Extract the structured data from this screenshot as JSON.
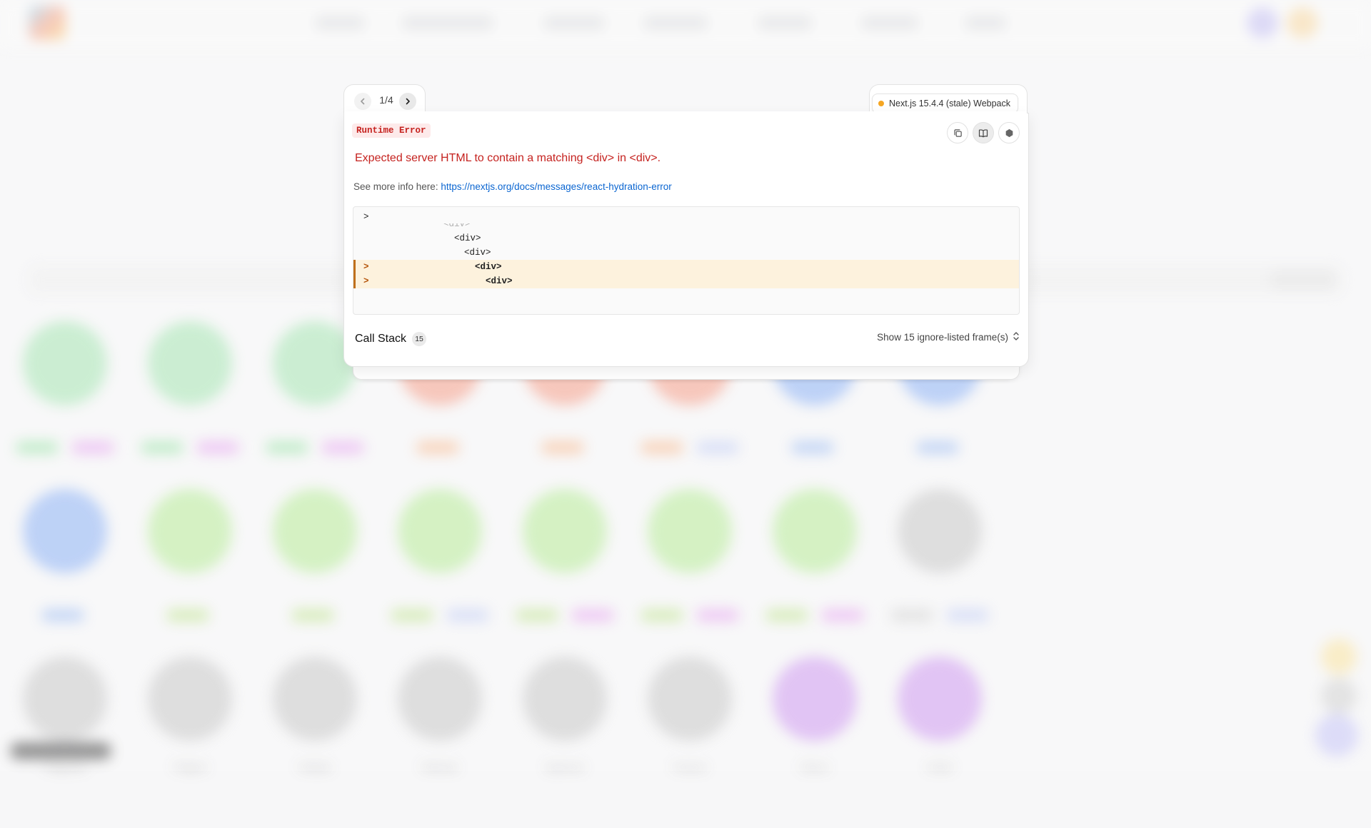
{
  "overlay": {
    "pagination": {
      "current": "1/4",
      "prev_icon": "chevron-left-icon",
      "next_icon": "chevron-right-icon"
    },
    "version": {
      "text": "Next.js 15.4.4 (stale) Webpack",
      "status_color": "#f5a623"
    },
    "error_type": "Runtime Error",
    "message": "Expected server HTML to contain a matching <div> in <div>.",
    "info_prefix": "See more info here:",
    "info_link": "https://nextjs.org/docs/messages/react-hydration-error",
    "toolbar_icons": [
      "copy-icon",
      "docs-icon",
      "nextjs-icon"
    ],
    "code_lines": [
      {
        "marker": ">",
        "text": "",
        "highlight": false
      },
      {
        "marker": "",
        "text": "<div>",
        "highlight": false
      },
      {
        "marker": "",
        "text": "<div>",
        "highlight": false
      },
      {
        "marker": "",
        "text": "<div>",
        "highlight": false
      },
      {
        "marker": ">",
        "text": "<div>",
        "highlight": true
      },
      {
        "marker": ">",
        "text": "<div>",
        "highlight": true
      }
    ],
    "call_stack": {
      "label": "Call Stack",
      "count": "15",
      "toggle_label": "Show 15 ignore-listed frame(s)"
    }
  },
  "background": {
    "pokemon_names_row3": [
      "Pidgeotto",
      "Pidgeot",
      "Rattata",
      "Raticate",
      "Spearow",
      "Fearow",
      "Ekans",
      "Arbok"
    ],
    "colors": {
      "grass": "#9be3a8",
      "fire": "#f5a08c",
      "water": "#8fb3f5",
      "bug": "#b8eb9a",
      "normal": "#c9c9c9",
      "poison": "#cf9bf0"
    }
  }
}
